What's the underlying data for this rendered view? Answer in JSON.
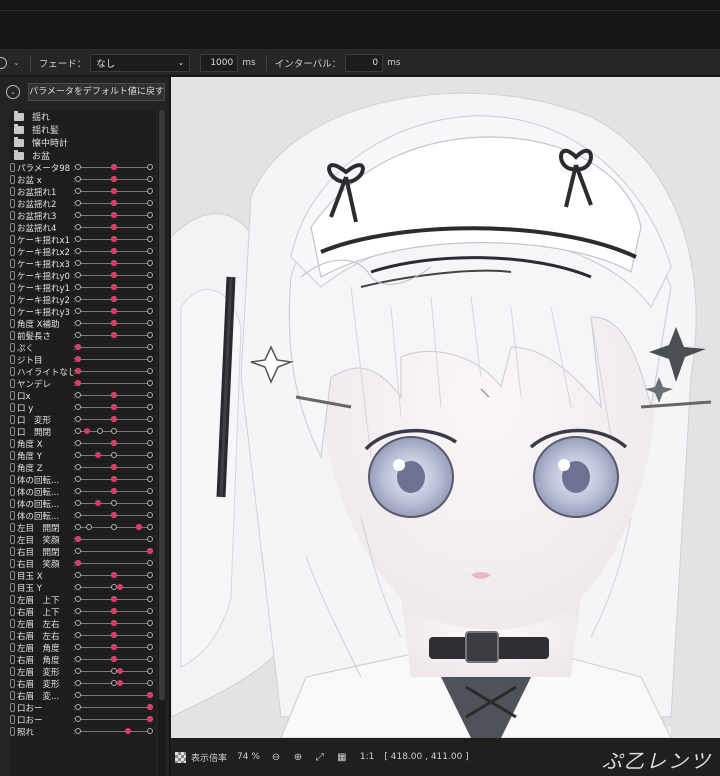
{
  "toolbar": {
    "fade_label": "フェード：",
    "fade_value": "なし",
    "fade_ms": "1000",
    "ms_unit": "ms",
    "interval_label": "インターバル：",
    "interval_ms": "0",
    "ms_unit2": "ms"
  },
  "panel": {
    "reset_button": "パラメータをデフォルト値に戻す",
    "folders": [
      "揺れ",
      "揺れ髪",
      "懐中時計",
      "お盆"
    ],
    "params": [
      {
        "name": "パラメータ98",
        "value": 0.5,
        "keys": "lmr"
      },
      {
        "name": "お盆 x",
        "value": 0.5,
        "keys": "lmr"
      },
      {
        "name": "お盆揺れ1",
        "value": 0.5,
        "keys": "lmr"
      },
      {
        "name": "お盆揺れ2",
        "value": 0.5,
        "keys": "lmr"
      },
      {
        "name": "お盆揺れ3",
        "value": 0.5,
        "keys": "lmr"
      },
      {
        "name": "お盆揺れ4",
        "value": 0.5,
        "keys": "lmr"
      },
      {
        "name": "ケーキ揺れx1",
        "value": 0.5,
        "keys": "lmr"
      },
      {
        "name": "ケーキ揺れx2",
        "value": 0.5,
        "keys": "lmr"
      },
      {
        "name": "ケーキ揺れx3",
        "value": 0.5,
        "keys": "lmr"
      },
      {
        "name": "ケーキ揺れy0",
        "value": 0.5,
        "keys": "lmr"
      },
      {
        "name": "ケーキ揺れy1",
        "value": 0.5,
        "keys": "lmr"
      },
      {
        "name": "ケーキ揺れy2",
        "value": 0.5,
        "keys": "lmr"
      },
      {
        "name": "ケーキ揺れy3",
        "value": 0.5,
        "keys": "lmr"
      },
      {
        "name": "角度 X補助",
        "value": 0.5,
        "keys": "lmr"
      },
      {
        "name": "前髪長さ",
        "value": 0.5,
        "keys": "lmr"
      },
      {
        "name": "ぷく",
        "value": 0.0,
        "keys": "lr"
      },
      {
        "name": "ジト目",
        "value": 0.0,
        "keys": "lr"
      },
      {
        "name": "ハイライトなし",
        "value": 0.0,
        "keys": "lr"
      },
      {
        "name": "ヤンデレ",
        "value": 0.0,
        "keys": "lr"
      },
      {
        "name": "口x",
        "value": 0.5,
        "keys": "lmr"
      },
      {
        "name": "口 y",
        "value": 0.5,
        "keys": "lmr"
      },
      {
        "name": "口　変形",
        "value": 0.5,
        "keys": "lmr"
      },
      {
        "name": "口　開閉",
        "value": 0.12,
        "keys": "lmr2"
      },
      {
        "name": "角度 X",
        "value": 0.5,
        "keys": "lmr"
      },
      {
        "name": "角度 Y",
        "value": 0.28,
        "keys": "lmr"
      },
      {
        "name": "角度 Z",
        "value": 0.5,
        "keys": "lmr"
      },
      {
        "name": "体の回転...",
        "value": 0.5,
        "keys": "lmr"
      },
      {
        "name": "体の回転...",
        "value": 0.5,
        "keys": "lmr"
      },
      {
        "name": "体の回転...",
        "value": 0.28,
        "keys": "lmr"
      },
      {
        "name": "体の回転...",
        "value": 0.5,
        "keys": "lmr"
      },
      {
        "name": "左目　開閉",
        "value": 0.85,
        "keys": "lm2r"
      },
      {
        "name": "左目　笑顔",
        "value": 0.0,
        "keys": "lr"
      },
      {
        "name": "右目　開閉",
        "value": 1.0,
        "keys": "lr"
      },
      {
        "name": "右目　笑顔",
        "value": 0.0,
        "keys": "lr"
      },
      {
        "name": "目玉 X",
        "value": 0.5,
        "keys": "lmr"
      },
      {
        "name": "目玉 Y",
        "value": 0.58,
        "keys": "lmr"
      },
      {
        "name": "左眉　上下",
        "value": 0.5,
        "keys": "lmr"
      },
      {
        "name": "右眉　上下",
        "value": 0.5,
        "keys": "lmr"
      },
      {
        "name": "左眉　左右",
        "value": 0.5,
        "keys": "lmr"
      },
      {
        "name": "右眉　左右",
        "value": 0.5,
        "keys": "lmr"
      },
      {
        "name": "左眉　角度",
        "value": 0.5,
        "keys": "lmr"
      },
      {
        "name": "右眉　角度",
        "value": 0.5,
        "keys": "lmr"
      },
      {
        "name": "左眉　変形",
        "value": 0.58,
        "keys": "lmr"
      },
      {
        "name": "右眉　変形",
        "value": 0.58,
        "keys": "lmr"
      },
      {
        "name": "右眉　変...",
        "value": 1.0,
        "keys": "lr"
      },
      {
        "name": "口おー",
        "value": 1.0,
        "keys": "lr"
      },
      {
        "name": "口おー",
        "value": 1.0,
        "keys": "lr"
      },
      {
        "name": "照れ",
        "value": 0.7,
        "keys": "lr"
      }
    ]
  },
  "statusbar": {
    "zoom_label": "表示倍率",
    "zoom_value": "74 %",
    "ratio": "1:1",
    "coords": "[ 418.00 , 411.00 ]",
    "signature": "ぷ乙レンツ"
  },
  "colors": {
    "accent": "#d83c66",
    "canvas_bg": "#e4e4e4"
  }
}
